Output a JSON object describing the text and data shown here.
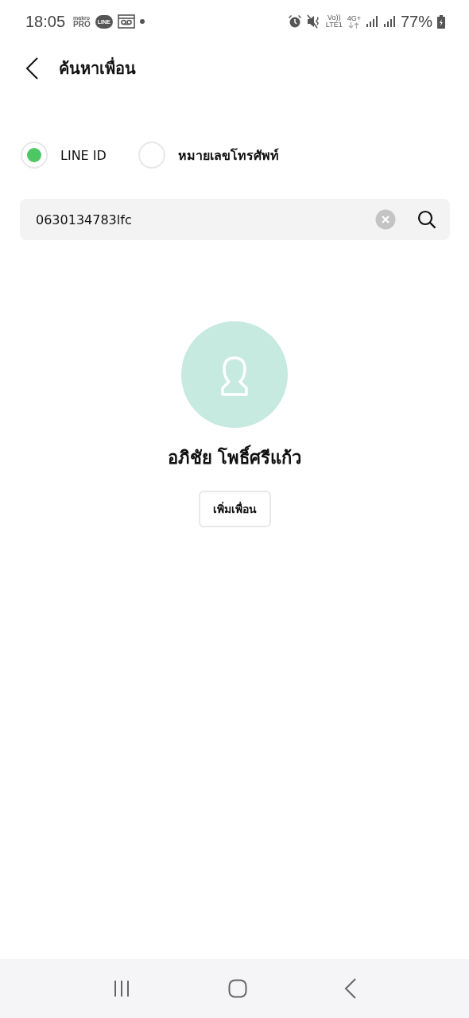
{
  "status_bar": {
    "time": "18:05",
    "app_marks": [
      {
        "kind": "makro",
        "top": "makro",
        "bottom": "PRO"
      },
      {
        "kind": "line",
        "top": "LINE"
      }
    ],
    "network": {
      "volte": "Vo))",
      "lte": "LTE1",
      "gen": "4G+"
    },
    "battery": "77%"
  },
  "header": {
    "title": "ค้นหาเพื่อน"
  },
  "search_type": [
    {
      "label": "LINE ID",
      "selected": true
    },
    {
      "label": "หมายเลขโทรศัพท์",
      "selected": false
    }
  ],
  "search": {
    "value": "0630134783lfc"
  },
  "result": {
    "name": "อภิชัย โพธิ์ศรีแก้ว",
    "button": "เพิ่มเพื่อน"
  }
}
